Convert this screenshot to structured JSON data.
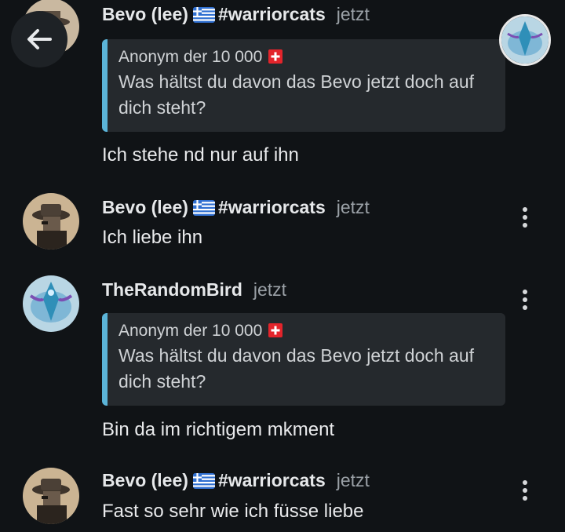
{
  "colors": {
    "background": "#101316",
    "quote_bar": "#5bb4d8",
    "quote_bg": "#25292d",
    "timestamp": "#9aa0a6"
  },
  "nav": {
    "back_icon": "arrow-left-icon"
  },
  "messages": [
    {
      "author": "Bevo (lee)",
      "flag": "greek-flag-icon",
      "tag": "#warriorcats",
      "time": "jetzt",
      "quote": {
        "author": "Anonym der 10 000",
        "flag": "swiss-flag-icon",
        "line1": "Was hältst du davon das Bevo jetzt doch auf",
        "line2": "dich steht?"
      },
      "text": "Ich stehe nd nur auf ihn"
    },
    {
      "author": "Bevo (lee)",
      "flag": "greek-flag-icon",
      "tag": "#warriorcats",
      "time": "jetzt",
      "text": "Ich liebe ihn"
    },
    {
      "author": "TheRandomBird",
      "time": "jetzt",
      "quote": {
        "author": "Anonym der 10 000",
        "flag": "swiss-flag-icon",
        "line1": "Was hältst du davon das Bevo jetzt doch auf",
        "line2": "dich steht?"
      },
      "text": "Bin da im richtigem mkment"
    },
    {
      "author": "Bevo (lee)",
      "flag": "greek-flag-icon",
      "tag": "#warriorcats",
      "time": "jetzt",
      "text": "Fast so sehr wie ich füsse liebe"
    }
  ]
}
